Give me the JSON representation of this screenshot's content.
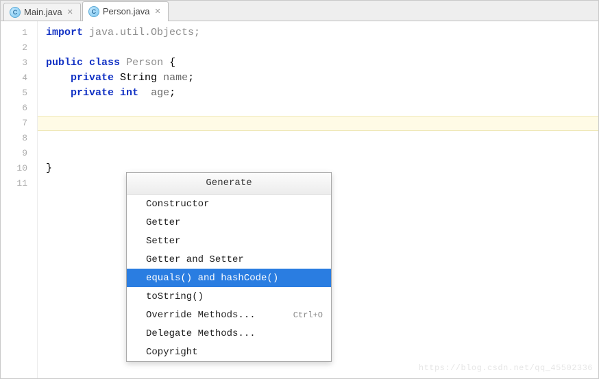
{
  "tabs": [
    {
      "icon_letter": "C",
      "label": "Main.java",
      "active": false
    },
    {
      "icon_letter": "C",
      "label": "Person.java",
      "active": true
    }
  ],
  "gutter_lines": [
    "1",
    "2",
    "3",
    "4",
    "5",
    "6",
    "7",
    "8",
    "9",
    "10",
    "11"
  ],
  "code": {
    "l1_kw": "import",
    "l1_rest": " java.util.Objects;",
    "l3_kw1": "public",
    "l3_kw2": "class",
    "l3_cls": "Person",
    "l3_rest": " {",
    "l4_kw": "private",
    "l4_type": "String",
    "l4_name": "name",
    "l4_semi": ";",
    "l5_kw": "private",
    "l5_type": "int",
    "l5_name": "age",
    "l5_semi": ";",
    "l10_close": "}"
  },
  "caret_line_index": 6,
  "popup": {
    "title": "Generate",
    "items": [
      {
        "label": "Constructor",
        "shortcut": "",
        "selected": false
      },
      {
        "label": "Getter",
        "shortcut": "",
        "selected": false
      },
      {
        "label": "Setter",
        "shortcut": "",
        "selected": false
      },
      {
        "label": "Getter and Setter",
        "shortcut": "",
        "selected": false
      },
      {
        "label": "equals() and hashCode()",
        "shortcut": "",
        "selected": true
      },
      {
        "label": "toString()",
        "shortcut": "",
        "selected": false
      },
      {
        "label": "Override Methods...",
        "shortcut": "Ctrl+O",
        "selected": false
      },
      {
        "label": "Delegate Methods...",
        "shortcut": "",
        "selected": false
      },
      {
        "label": "Copyright",
        "shortcut": "",
        "selected": false
      }
    ]
  },
  "watermark": "https://blog.csdn.net/qq_45502336"
}
